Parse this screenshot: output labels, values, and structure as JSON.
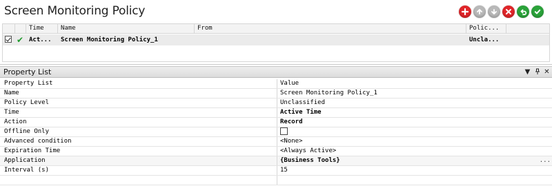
{
  "window": {
    "title": "Screen Monitoring Policy"
  },
  "toolbar": {
    "buttons": [
      {
        "name": "add",
        "icon": "plus-icon",
        "color": "#e0262a"
      },
      {
        "name": "move-up",
        "icon": "arrow-up-icon",
        "color": "#b9b9b9"
      },
      {
        "name": "move-down",
        "icon": "arrow-down-icon",
        "color": "#b9b9b9"
      },
      {
        "name": "delete",
        "icon": "x-icon",
        "color": "#e0262a"
      },
      {
        "name": "undo",
        "icon": "undo-icon",
        "color": "#2ba33a"
      },
      {
        "name": "apply",
        "icon": "check-icon",
        "color": "#2ba33a"
      }
    ]
  },
  "policy_grid": {
    "columns": [
      "Time",
      "Name",
      "From",
      "Polic..."
    ],
    "rows": [
      {
        "checked": true,
        "enabled_icon": "green-check-icon",
        "time": "Act...",
        "name": "Screen Monitoring Policy_1",
        "from": "",
        "policy": "Uncla..."
      }
    ]
  },
  "property_list": {
    "pane_title": "Property List",
    "pane_controls": [
      "dropdown-arrow-icon",
      "pin-icon",
      "close-icon"
    ],
    "header": {
      "name": "Property List",
      "value": "Value"
    },
    "rows": [
      {
        "name": "Name",
        "value": "Screen Monitoring Policy_1"
      },
      {
        "name": "Policy Level",
        "value": "Unclassified"
      },
      {
        "name": "Time",
        "value": "Active Time",
        "bold": true
      },
      {
        "name": "Action",
        "value": "Record",
        "bold": true
      },
      {
        "name": "Offline Only",
        "value": "",
        "checkbox": true,
        "checked": false
      },
      {
        "name": "Advanced condition",
        "value": "<None>"
      },
      {
        "name": "Expiration Time",
        "value": "<Always Active>"
      },
      {
        "name": "Application",
        "value": "{Business Tools}",
        "bold": true,
        "has_ellipsis": true,
        "ellipsis": "..."
      },
      {
        "name": "Interval (s)",
        "value": "15"
      }
    ]
  }
}
